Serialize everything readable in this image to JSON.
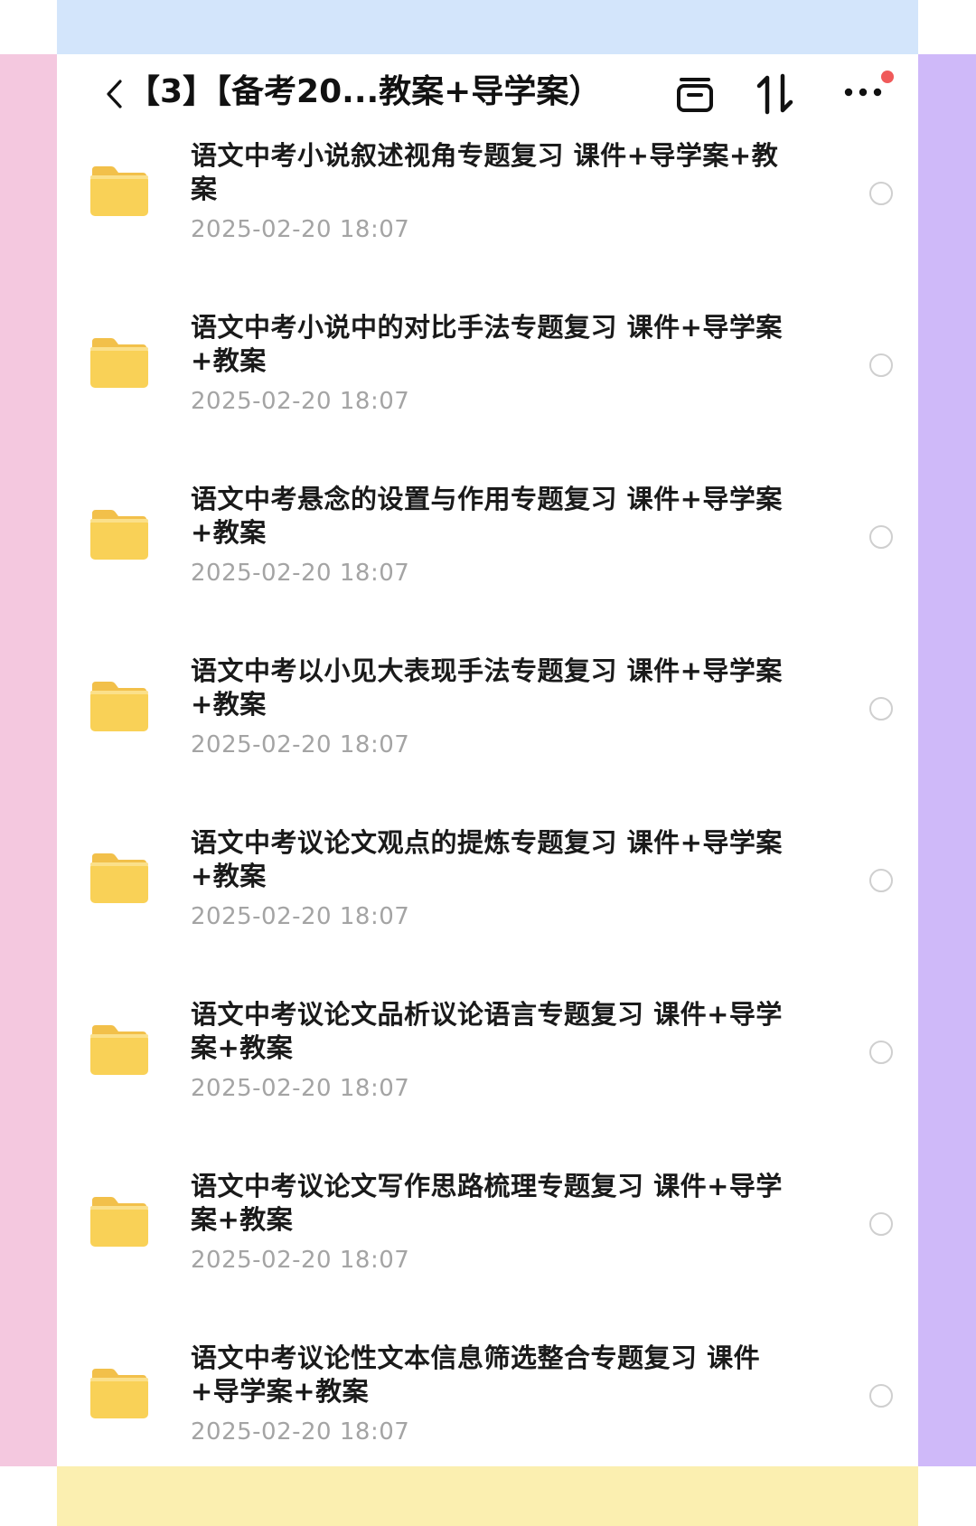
{
  "header": {
    "title": "【3】【备考20...教案+导学案）",
    "archive_icon": "archive-box-icon",
    "sort_icon": "sort-arrows-icon",
    "more_icon": "more-dots-icon",
    "notification_dot_color": "#f05a5a"
  },
  "items": [
    {
      "name": "语文中考小说叙述视角专题复习 课件+导学案+教案",
      "date": "2025-02-20 18:07",
      "icon": "folder-icon"
    },
    {
      "name": "语文中考小说中的对比手法专题复习 课件+导学案+教案",
      "date": "2025-02-20 18:07",
      "icon": "folder-icon"
    },
    {
      "name": "语文中考悬念的设置与作用专题复习 课件+导学案+教案",
      "date": "2025-02-20 18:07",
      "icon": "folder-icon"
    },
    {
      "name": "语文中考以小见大表现手法专题复习 课件+导学案+教案",
      "date": "2025-02-20 18:07",
      "icon": "folder-icon"
    },
    {
      "name": "语文中考议论文观点的提炼专题复习 课件+导学案+教案",
      "date": "2025-02-20 18:07",
      "icon": "folder-icon"
    },
    {
      "name": "语文中考议论文品析议论语言专题复习 课件+导学案+教案",
      "date": "2025-02-20 18:07",
      "icon": "folder-icon"
    },
    {
      "name": "语文中考议论文写作思路梳理专题复习 课件+导学案+教案",
      "date": "2025-02-20 18:07",
      "icon": "folder-icon"
    },
    {
      "name": "语文中考议论性文本信息筛选整合专题复习 课件+导学案+教案",
      "date": "2025-02-20 18:07",
      "icon": "folder-icon"
    }
  ],
  "colors": {
    "folder": "#f8cd4f",
    "date_text": "#a4a4a4",
    "decor_top": "#d3e5fb",
    "decor_left": "#f4c8df",
    "decor_right": "#cfb9f9",
    "decor_bottom": "#fbefb0"
  }
}
